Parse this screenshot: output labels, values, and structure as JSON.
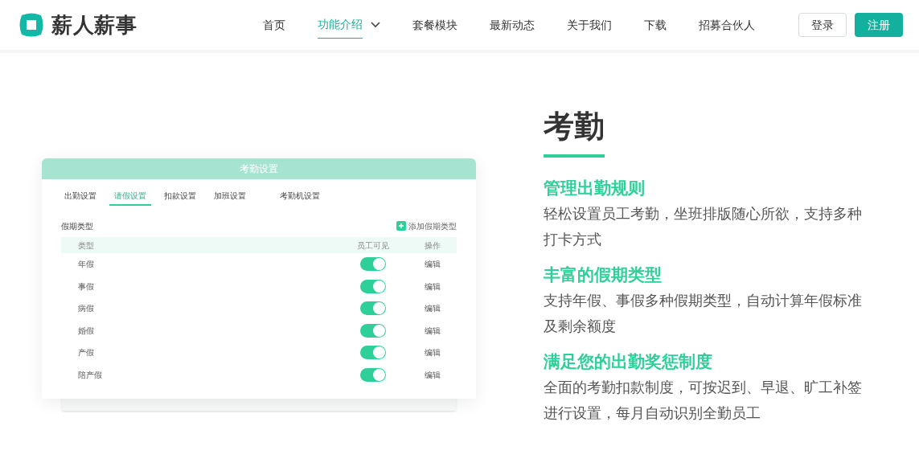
{
  "header": {
    "brand": "薪人薪事",
    "nav": [
      {
        "label": "首页",
        "selected": false,
        "dropdown": false
      },
      {
        "label": "功能介绍",
        "selected": true,
        "dropdown": true
      },
      {
        "label": "套餐模块",
        "selected": false,
        "dropdown": false
      },
      {
        "label": "最新动态",
        "selected": false,
        "dropdown": false
      },
      {
        "label": "关于我们",
        "selected": false,
        "dropdown": false
      },
      {
        "label": "下载",
        "selected": false,
        "dropdown": false
      },
      {
        "label": "招募合伙人",
        "selected": false,
        "dropdown": false
      }
    ],
    "login": "登录",
    "register": "注册"
  },
  "mockup": {
    "title": "考勤设置",
    "tabs": [
      {
        "label": "出勤设置",
        "selected": false
      },
      {
        "label": "请假设置",
        "selected": true
      },
      {
        "label": "扣款设置",
        "selected": false
      },
      {
        "label": "加班设置",
        "selected": false
      },
      {
        "label": "考勤机设置",
        "selected": false
      }
    ],
    "section": "假期类型",
    "add": "添加假期类型",
    "columns": [
      "类型",
      "员工可见",
      "操作"
    ],
    "rows": [
      {
        "type": "年假",
        "visible": true,
        "action": "编辑"
      },
      {
        "type": "事假",
        "visible": true,
        "action": "编辑"
      },
      {
        "type": "病假",
        "visible": true,
        "action": "编辑"
      },
      {
        "type": "婚假",
        "visible": true,
        "action": "编辑"
      },
      {
        "type": "产假",
        "visible": true,
        "action": "编辑"
      },
      {
        "type": "陪产假",
        "visible": true,
        "action": "编辑"
      }
    ]
  },
  "feature": {
    "title": "考勤",
    "points": [
      {
        "heading": "管理出勤规则",
        "text": "轻松设置员工考勤，坐班排版随心所欲，支持多种打卡方式"
      },
      {
        "heading": "丰富的假期类型",
        "text": "支持年假、事假多种假期类型，自动计算年假标准及剩余额度"
      },
      {
        "heading": "满足您的出勤奖惩制度",
        "text": "全面的考勤扣款制度，可按迟到、早退、旷工补签进行设置，每月自动识别全勤员工"
      }
    ]
  }
}
